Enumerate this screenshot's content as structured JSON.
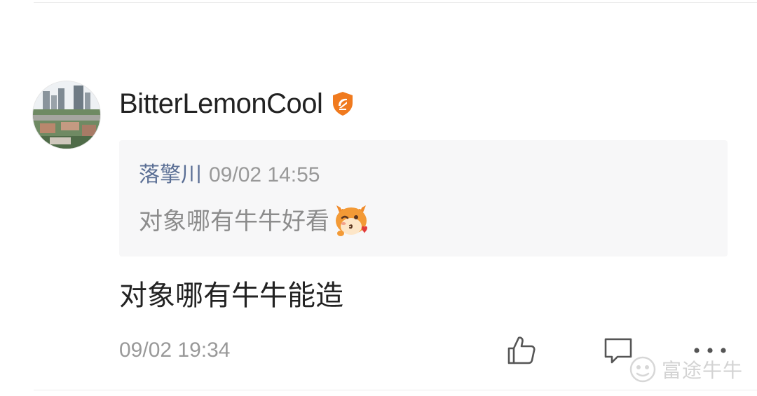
{
  "comment": {
    "author": "BitterLemonCool",
    "text": "对象哪有牛牛能造",
    "time": "09/02 19:34",
    "badge_icon": "verified-shield-icon"
  },
  "quoted_comment": {
    "author": "落擎川",
    "time": "09/02 14:55",
    "text": "对象哪有牛牛好看",
    "emoji_icon": "cow-wink-emoji"
  },
  "actions": {
    "like_icon": "thumbs-up-icon",
    "reply_icon": "comment-bubble-icon",
    "more_icon": "more-dots-icon"
  },
  "watermark": {
    "text": "富途牛牛",
    "icon": "futu-logo-icon"
  },
  "colors": {
    "badge": "#f07a1e",
    "quote_author": "#5b6f95",
    "meta_gray": "#999999",
    "primary_text": "#222222",
    "quote_bg": "#f7f7f8"
  }
}
